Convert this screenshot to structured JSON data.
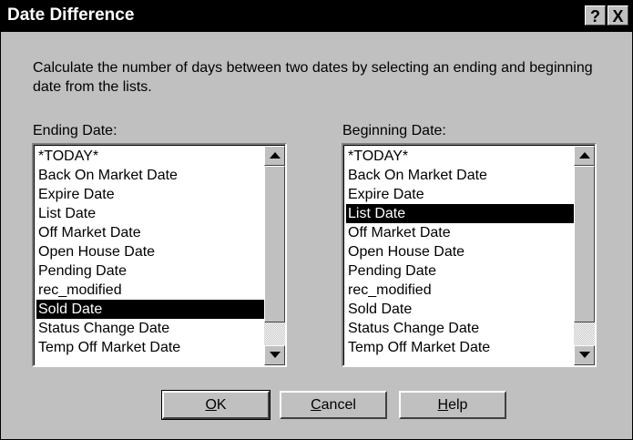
{
  "window": {
    "title": "Date Difference",
    "help_button": "?",
    "close_button": "X"
  },
  "description": "Calculate the number of days between two dates by selecting an ending and beginning date from the lists.",
  "ending": {
    "label": "Ending Date:",
    "selected": "Sold Date",
    "items": [
      "*TODAY*",
      "Back On Market Date",
      "Expire Date",
      "List Date",
      "Off Market Date",
      "Open House Date",
      "Pending Date",
      "rec_modified",
      "Sold Date",
      "Status Change Date",
      "Temp Off Market Date"
    ]
  },
  "beginning": {
    "label": "Beginning Date:",
    "selected": "List Date",
    "items": [
      "*TODAY*",
      "Back On Market Date",
      "Expire Date",
      "List Date",
      "Off Market Date",
      "Open House Date",
      "Pending Date",
      "rec_modified",
      "Sold Date",
      "Status Change Date",
      "Temp Off Market Date"
    ]
  },
  "buttons": {
    "ok": {
      "accel": "O",
      "rest": "K"
    },
    "cancel": {
      "accel": "C",
      "rest": "ancel"
    },
    "help": {
      "accel": "H",
      "rest": "elp"
    }
  },
  "icons": {
    "scroll_up": "triangle-up-icon",
    "scroll_down": "triangle-down-icon"
  }
}
